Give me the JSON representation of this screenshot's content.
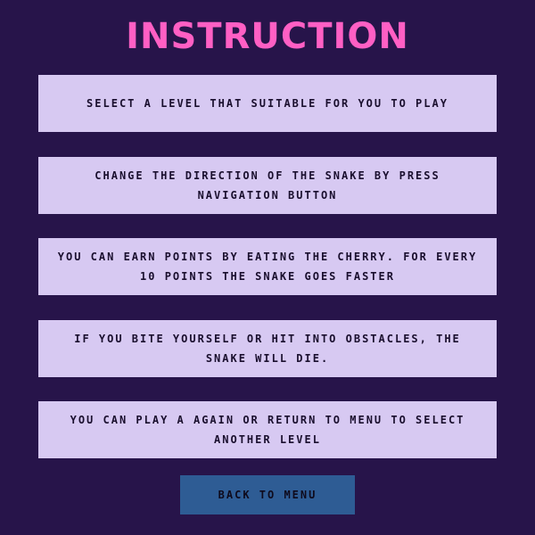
{
  "title": "INSTRUCTION",
  "instructions": [
    "Select a level that suitable for you to play",
    "Change the direction of the snake by press navigation button",
    "You can earn points by eating the cherry. For every 10 points the snake goes faster",
    "If you bite yourself or hit into obstacles, the snake will die.",
    "You can play a again or return to menu to select another level"
  ],
  "back_button": "Back to Menu",
  "colors": {
    "background": "#27144a",
    "title": "#ff5fc4",
    "card": "#d7c9f2",
    "button": "#2e5c94",
    "text": "#1a0f2e"
  }
}
